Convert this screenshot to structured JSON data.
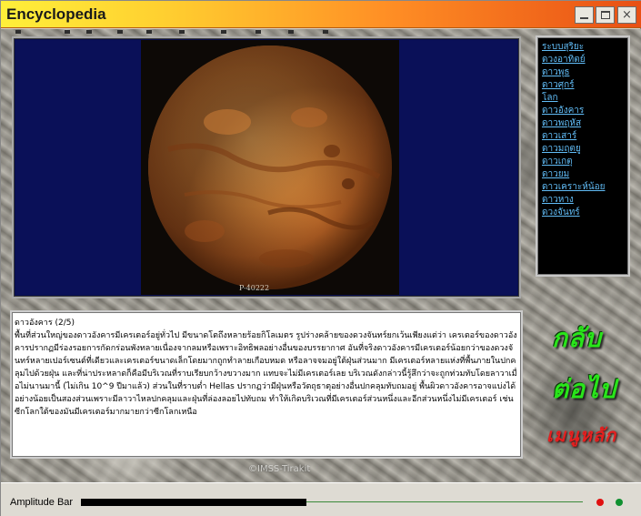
{
  "window": {
    "title": "Encyclopedia",
    "controls": {
      "minimize": "minimize-icon",
      "maximize": "maximize-icon",
      "close": "×"
    }
  },
  "image": {
    "credit": "P-40222",
    "subject": "mars-photo"
  },
  "planet_menu": {
    "items": [
      "ระบบสุริยะ",
      "ดวงอาทิตย์",
      "ดาวพุธ",
      "ดาวศุกร์",
      "โลก",
      "ดาวอังคาร",
      "ดาวพฤหัส",
      "ดาวเสาร์",
      "ดาวมฤตยู",
      "ดาวเกตุ",
      "ดาวยม",
      "ดาวเคราะห์น้อย",
      "ดาวหาง",
      "ดวงจันทร์"
    ],
    "link_color": "#61bcf6"
  },
  "article": {
    "heading": "ดาวอังคาร (2/5)",
    "body": "พื้นที่ส่วนใหญ่ของดาวอังคารมีเครเตอร์อยู่ทั่วไป มีขนาดโตถึงหลายร้อยกิโลเมตร รูปร่างคล้ายของดวงจันทร์ยกเว้นเพียงแต่ว่า เครเตอร์ของดาวอังคารปรากฏมีร่องรอยการกัดกร่อนพังทลายเนื่องจากลมหรือเพราะอิทธิพลอย่างอื่นของบรรยากาศ อันที่จริงดาวอังคารมีเครเตอร์น้อยกว่าของดวงจันทร์หลายเปอร์เซนต์ที่เดียวและเครเตอร์ขนาดเล็กโดยมากถูกทำลายเกือบหมด หรือลาจจมอยู่ใต้ฝุ่นส่วนมาก มีเครเตอร์หลายแห่งที่พื้นภายในปกคลุมไปด้วยฝุ่น และที่น่าประหลาดก็คือมีบริเวณที่ราบเรียบกว้างขวางมาก แทบจะไม่มีเครเตอร์เลย บริเวณดังกล่าวนี้รู้สึกว่าจะถูกท่วมทับโดยลาวาเมื่อไม่นานมานี้ (ไม่เกิน 10^9 ปีมาแล้ว) ส่วนในที่ราบต่ำ Hellas ปรากฏว่ามีฝุ่นหรือวัตถุธาตุอย่างอื่นปกคลุมทับถมอยู่ พื้นผิวดาวอังคารอาจแบ่งได้อย่างน้อยเป็นสองส่วนเพราะมีลาวาไหลปกคลุมและฝุ่นที่ล่องลอยไปทับถม ทำให้เกิดบริเวณที่มีเครเตอร์ส่วนหนึ่งและอีกส่วนหนึ่งไม่มีเครเตอร์ เช่นซีกโลกใต้ของมันมีเครเตอร์มากมายกว่าซีกโลกเหนือ"
  },
  "nav": {
    "back_label": "กลับ",
    "next_label": "ต่อไป",
    "menu_label": "เมนูหลัก",
    "back_color": "#29e51a",
    "next_color": "#29e51a",
    "menu_color": "#e51f1f"
  },
  "watermark": "©IMSS-Tirakit",
  "status_bar": {
    "label": "Amplitude Bar",
    "amplitude_fraction": 0.45,
    "indicator_colors": [
      "#e01010",
      "#109030"
    ]
  }
}
